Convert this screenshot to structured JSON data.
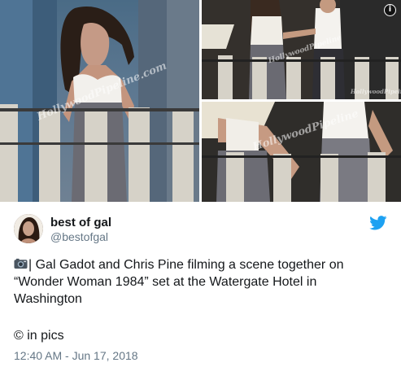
{
  "media": {
    "info_badge": "i",
    "watermarks": {
      "left": "HollywoodPipeline.com",
      "top_right_mid": "HollywoodPipeline",
      "top_right_corner": "HollywoodPipeline",
      "bottom_right": "HollywoodPipeline"
    }
  },
  "user": {
    "display_name": "best of gal",
    "handle": "@bestofgal"
  },
  "tweet": {
    "text": "| Gal Gadot and Chris Pine filming a scene together on “Wonder Woman 1984” set at the Watergate Hotel in Washington",
    "credit": "© in pics",
    "timestamp": "12:40 AM - Jun 17, 2018"
  },
  "icons": {
    "camera": "camera-emoji-icon",
    "twitter": "twitter-bird-icon",
    "info": "info-icon"
  },
  "colors": {
    "twitter_blue": "#1da1f2",
    "secondary_text": "#657786",
    "primary_text": "#14171a"
  }
}
